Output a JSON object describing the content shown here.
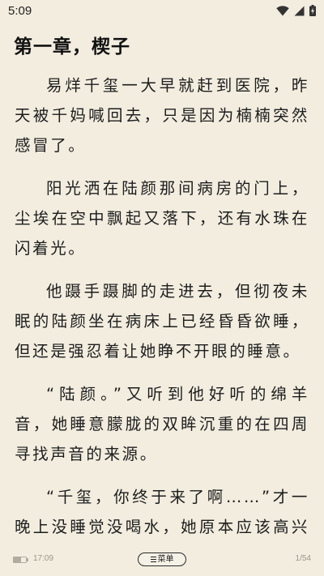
{
  "status_bar": {
    "time": "5:09",
    "icons": [
      "wifi-icon",
      "cell-signal-icon",
      "battery-charging-icon"
    ]
  },
  "chapter": {
    "title": "第一章，楔子",
    "paragraphs": [
      "易烊千玺一大早就赶到医院，昨天被千妈喊回去，只是因为楠楠突然感冒了。",
      "阳光洒在陆颜那间病房的门上，尘埃在空中飘起又落下，还有水珠在闪着光。",
      "他蹑手蹑脚的走进去，但彻夜未眠的陆颜坐在病床上已经昏昏欲睡，但还是强忍着让她睁不开眼的睡意。",
      "“陆颜。”又听到他好听的绵羊音，她睡意朦胧的双眸沉重的在四周寻找声音的来源。",
      "“千玺，你终于来了啊……”才一晚上没睡觉没喝水，她原本应该高兴的声音突然之间沙哑起来。"
    ]
  },
  "footer": {
    "time": "17:09",
    "menu_label": "菜单",
    "page": "1/54",
    "battery_level": 0.6
  },
  "colors": {
    "background": "#f2eddf",
    "text": "#1d1d1d",
    "muted": "#9a968a"
  }
}
